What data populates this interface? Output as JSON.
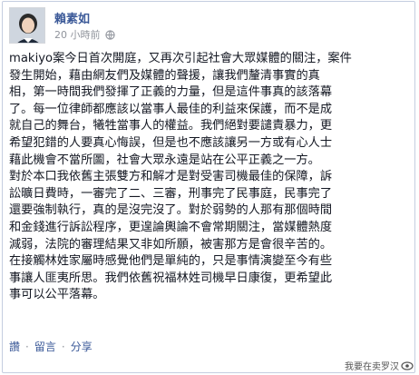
{
  "post": {
    "author": "賴素如",
    "timestamp": "20 小時前",
    "privacy_icon": "globe-icon",
    "lines": [
      "makiyo案今日首次開庭，又再次引起社會大眾媒體的關注，案件",
      "發生開始，藉由網友們及媒體的聲援，讓我們釐清事實的真",
      "相，第一時間我們發揮了正義的力量，但是這件事真的該落幕",
      "了。每一位律師都應該以當事人最佳的利益來保護，而不是成",
      "就自己的舞台，犧牲當事人的權益。我們絕對要譴責暴力，更",
      "希望犯錯的人要真心悔誤，但是也不應該讓另一方或有心人士",
      "藉此機會不當所圖，社會大眾永遠是站在公平正義之一方。",
      "對於本口我依舊主張雙方和解才是對受害司機最佳的保障，訴",
      "訟曠日費時，一審完了二、三審，刑事完了民事庭，民事完了",
      "還要強制執行，真的是沒完沒了。對於弱勢的人那有那個時間",
      "和金錢進行訴訟程序，更遑論輿論不會常期關注，當媒體熱度",
      "減弱，法院的審理結果又非如所願，被害那方是會很辛苦的。",
      "在接觸林姓家屬時感覺他們是單純的，只是事情演變至今有些",
      "事讓人匪夷所思。我們依舊祝福林姓司機早日康復，更希望此",
      "事可以公平落幕。"
    ]
  },
  "actions": {
    "like": "讚",
    "comment": "留言",
    "share": "分享",
    "separator": "·"
  },
  "watermark": {
    "text": "我要在卖罗汉",
    "icon": "eye-logo-icon"
  }
}
